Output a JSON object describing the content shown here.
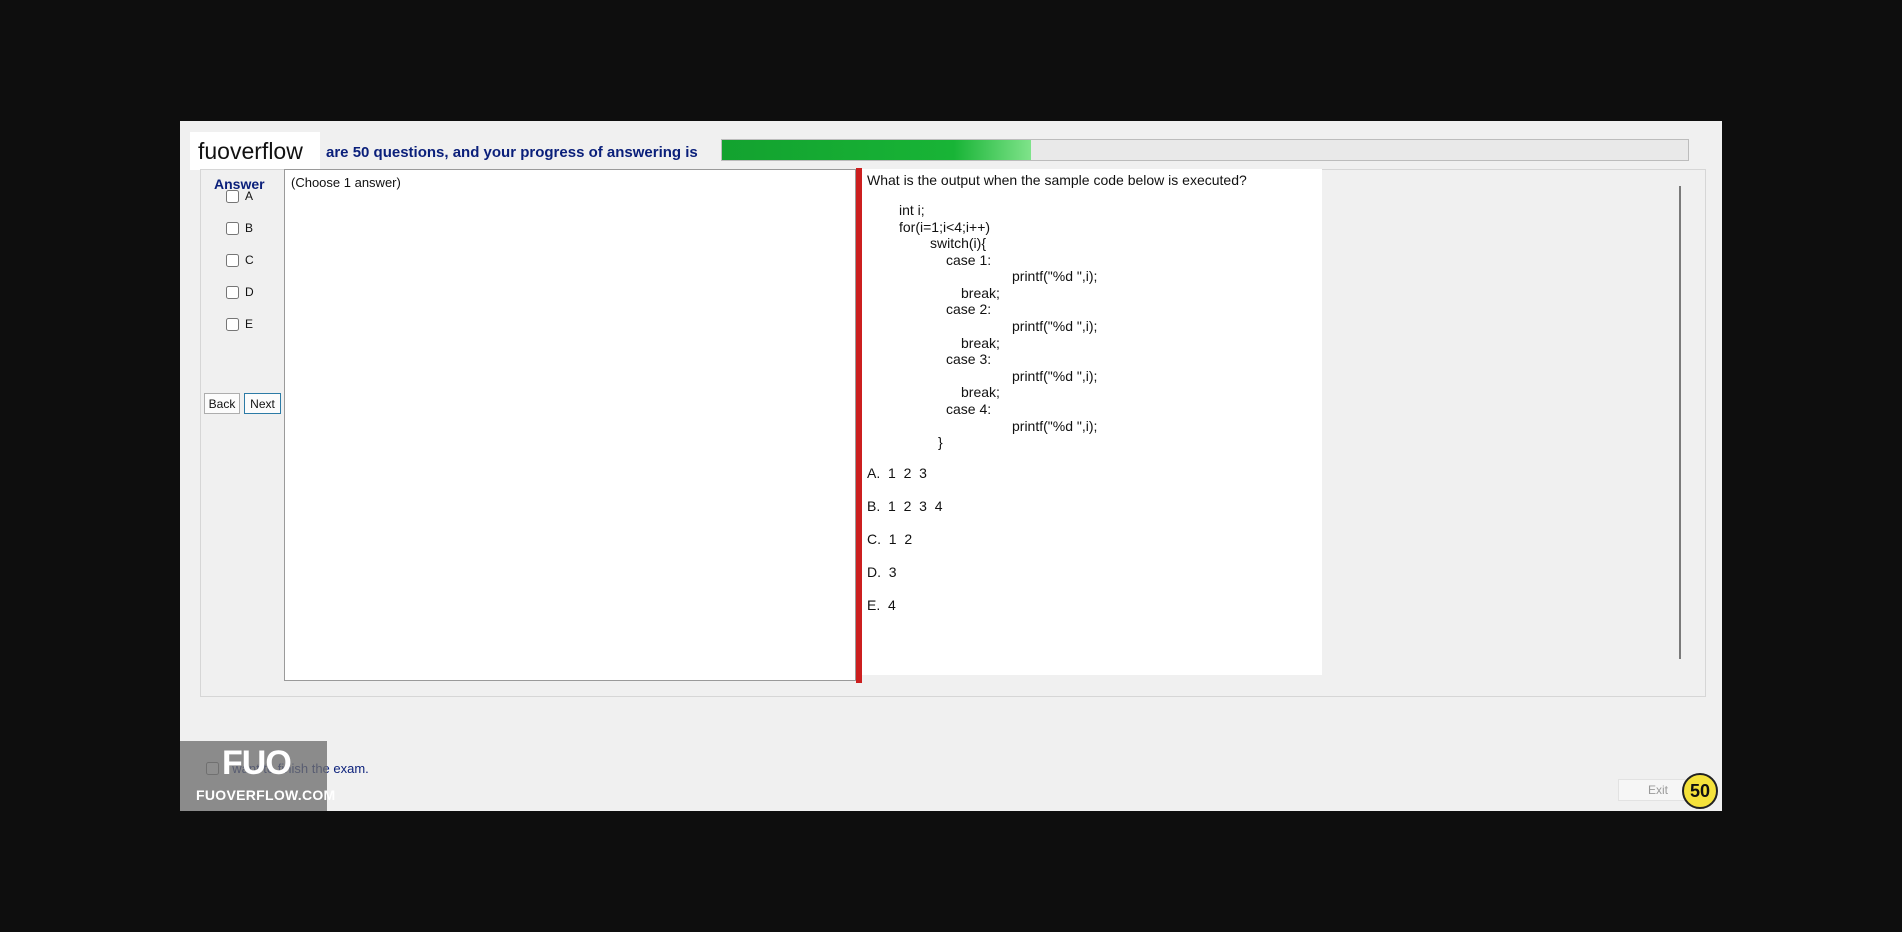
{
  "header": {
    "brand": "fuoverflow",
    "progress_text": "are 50 questions, and your progress of answering is",
    "progress_fraction": 0.32,
    "progress_color": "#18b436"
  },
  "answer_panel": {
    "title": "Answer",
    "options": [
      "A",
      "B",
      "C",
      "D",
      "E"
    ],
    "back_label": "Back",
    "next_label": "Next"
  },
  "choose_panel": {
    "instruction": "(Choose 1 answer)"
  },
  "question": {
    "prompt": "What is the output when the sample code below is executed?",
    "code_lines": [
      "int i;",
      "for(i=1;i<4;i++)",
      "switch(i){",
      "case 1:",
      "printf(\"%d \",i);",
      "break;",
      "case 2:",
      "printf(\"%d \",i);",
      "break;",
      "case 3:",
      "printf(\"%d \",i);",
      "break;",
      "case 4:",
      "printf(\"%d \",i);",
      "}"
    ],
    "choices": [
      "A.  1  2  3",
      "B.  1  2  3  4",
      "C.  1  2",
      "D.  3",
      "E.  4"
    ]
  },
  "footer": {
    "finish_text": "I want to finish the exam.",
    "exit_label": "Exit",
    "timer": "50"
  },
  "watermark": {
    "main": "FUO",
    "sub": "FUOVERFLOW.COM"
  },
  "colors": {
    "splitter": "#cc1f1f",
    "accent_text": "#0a1f7a",
    "timer_bg": "#f5e23b"
  }
}
